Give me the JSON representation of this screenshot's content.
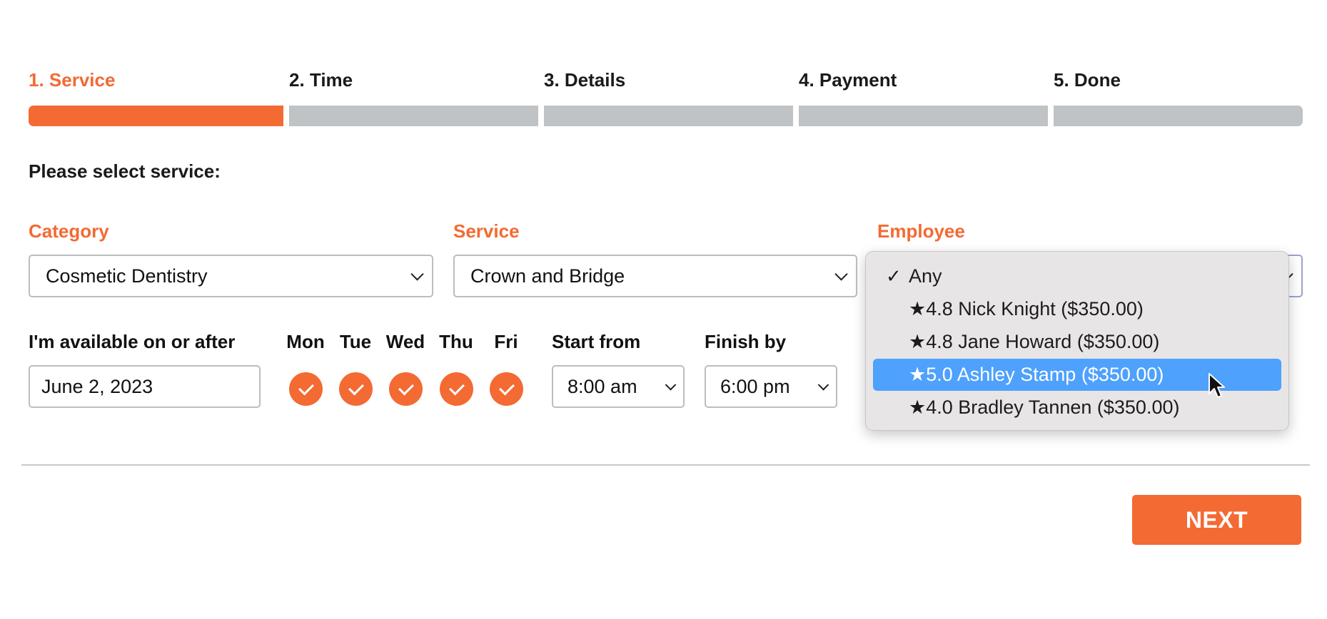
{
  "steps": [
    {
      "label": "1. Service",
      "active": true
    },
    {
      "label": "2. Time",
      "active": false
    },
    {
      "label": "3. Details",
      "active": false
    },
    {
      "label": "4. Payment",
      "active": false
    },
    {
      "label": "5. Done",
      "active": false
    }
  ],
  "prompt": "Please select service:",
  "category": {
    "label": "Category",
    "value": "Cosmetic Dentistry"
  },
  "service": {
    "label": "Service",
    "value": "Crown and Bridge"
  },
  "employee": {
    "label": "Employee",
    "options": [
      {
        "text": "Any",
        "checked": true
      },
      {
        "text": "★4.8 Nick Knight ($350.00)"
      },
      {
        "text": "★4.8 Jane Howard ($350.00)"
      },
      {
        "text": "★5.0 Ashley Stamp ($350.00)",
        "highlighted": true
      },
      {
        "text": "★4.0 Bradley Tannen ($350.00)"
      }
    ],
    "check_mark": "✓"
  },
  "availability": {
    "label": "I'm available on or after",
    "date": "June 2, 2023",
    "days": [
      "Mon",
      "Tue",
      "Wed",
      "Thu",
      "Fri"
    ],
    "start_label": "Start from",
    "start_value": "8:00 am",
    "finish_label": "Finish by",
    "finish_value": "6:00 pm"
  },
  "next_label": "NEXT",
  "colors": {
    "accent": "#f36a33",
    "inactive_bar": "#bfc3c5",
    "highlight": "#4ea1fc"
  }
}
